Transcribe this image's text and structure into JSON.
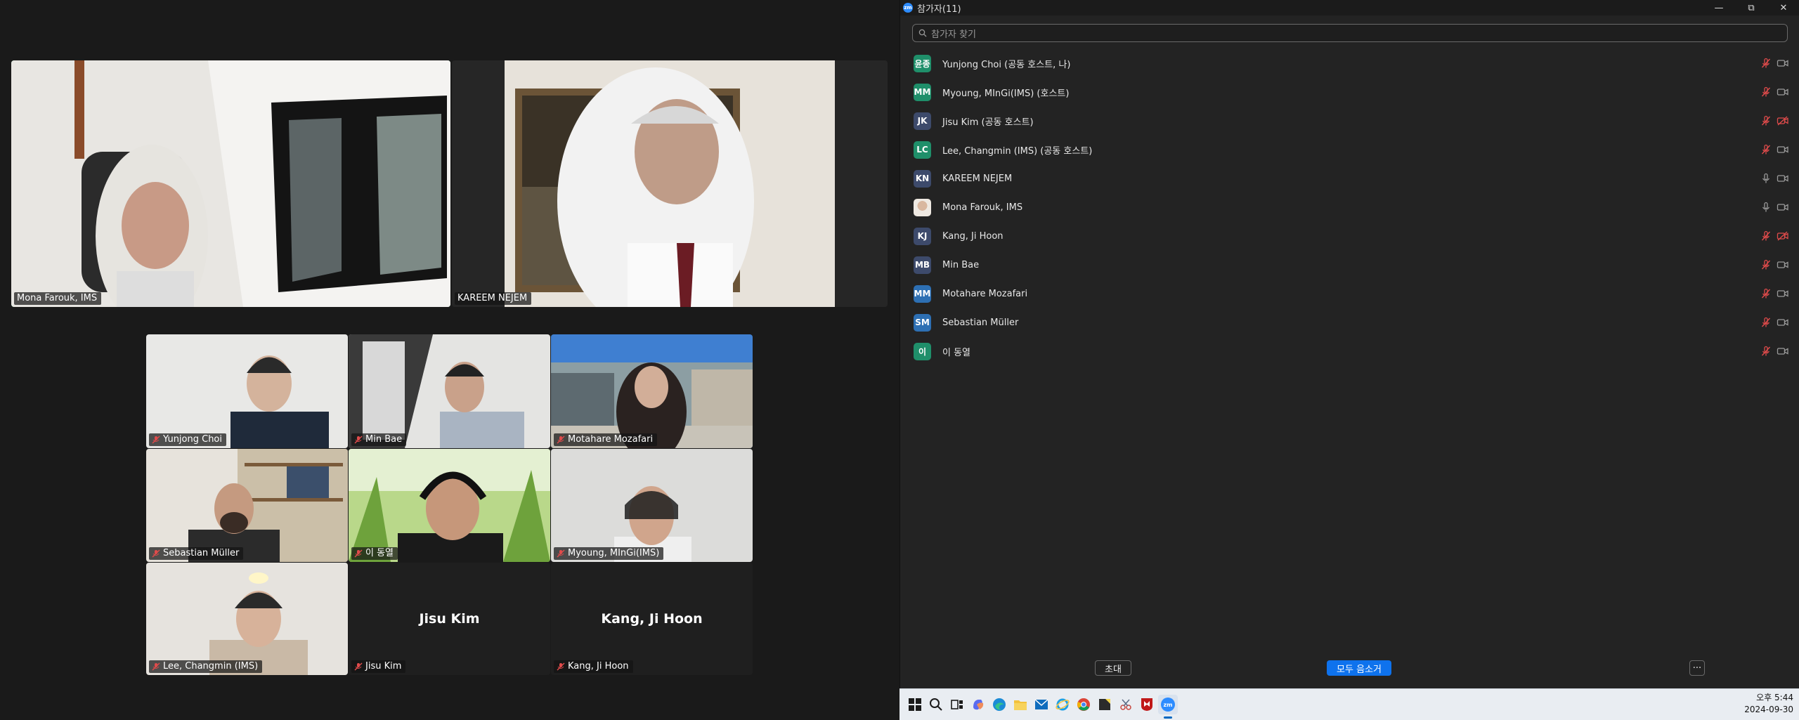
{
  "window": {
    "title": "참가자(11)",
    "app_icon": "zoom-logo",
    "app_icon_text": "zm"
  },
  "search": {
    "placeholder": "참가자 찾기"
  },
  "participants": [
    {
      "initials": "윤종",
      "name": "Yunjong Choi (공동 호스트, 나)",
      "avatar_color": "#1f8f6a",
      "mic": "muted",
      "camera": "on"
    },
    {
      "initials": "MM",
      "name": "Myoung, MInGi(IMS) (호스트)",
      "avatar_color": "#1f8f6a",
      "mic": "muted",
      "camera": "on"
    },
    {
      "initials": "JK",
      "name": "Jisu Kim (공동 호스트)",
      "avatar_color": "#3d4a6b",
      "mic": "muted",
      "camera": "off"
    },
    {
      "initials": "LC",
      "name": "Lee, Changmin (IMS) (공동 호스트)",
      "avatar_color": "#1f8f6a",
      "mic": "muted",
      "camera": "on"
    },
    {
      "initials": "KN",
      "name": "KAREEM NEJEM",
      "avatar_color": "#3d4a6b",
      "mic": "on",
      "camera": "on"
    },
    {
      "initials": "",
      "name": "Mona Farouk, IMS",
      "avatar_color": "photo",
      "mic": "on",
      "camera": "on"
    },
    {
      "initials": "KJ",
      "name": "Kang, Ji Hoon",
      "avatar_color": "#3d4a6b",
      "mic": "muted",
      "camera": "off"
    },
    {
      "initials": "MB",
      "name": "Min Bae",
      "avatar_color": "#3d4a6b",
      "mic": "muted",
      "camera": "on"
    },
    {
      "initials": "MM",
      "name": "Motahare Mozafari",
      "avatar_color": "#2d6fb3",
      "mic": "muted",
      "camera": "on"
    },
    {
      "initials": "SM",
      "name": "Sebastian Müller",
      "avatar_color": "#2d6fb3",
      "mic": "muted",
      "camera": "on"
    },
    {
      "initials": "이",
      "name": "이 동열",
      "avatar_color": "#1f8f6a",
      "mic": "muted",
      "camera": "on"
    }
  ],
  "footer": {
    "invite_label": "초대",
    "mute_all_label": "모두 음소거",
    "more_label": "···"
  },
  "video_tiles": {
    "top": [
      {
        "name": "Mona Farouk, IMS",
        "active_speaker": true
      },
      {
        "name": "KAREEM NEJEM",
        "active_speaker": false
      }
    ],
    "grid": [
      {
        "name": "Yunjong Choi",
        "muted": true
      },
      {
        "name": "Min Bae",
        "muted": true
      },
      {
        "name": "Motahare Mozafari",
        "muted": true
      },
      {
        "name": "Sebastian Müller",
        "muted": true
      },
      {
        "name": "이 동열",
        "muted": true
      },
      {
        "name": "Myoung, MInGi(IMS)",
        "muted": true
      },
      {
        "name": "Lee, Changmin (IMS)",
        "muted": true
      },
      {
        "name": "Jisu Kim",
        "muted": true,
        "camera_off": true,
        "display_name": "Jisu Kim"
      },
      {
        "name": "Kang, Ji Hoon",
        "muted": true,
        "camera_off": true,
        "display_name": "Kang, Ji Hoon"
      }
    ]
  },
  "taskbar": {
    "apps": [
      "windows-start-icon",
      "search-icon",
      "task-view-icon",
      "copilot-icon",
      "edge-icon",
      "file-explorer-icon",
      "mail-icon",
      "internet-explorer-icon",
      "chrome-icon",
      "sticky-notes-icon",
      "snipping-tool-icon",
      "mcafee-icon",
      "zoom-icon"
    ],
    "time": "오후 5:44",
    "date": "2024-09-30"
  },
  "colors": {
    "active_speaker_border": "#34c97a",
    "muted_red": "#e04b4b",
    "primary_button": "#0e72ed"
  }
}
